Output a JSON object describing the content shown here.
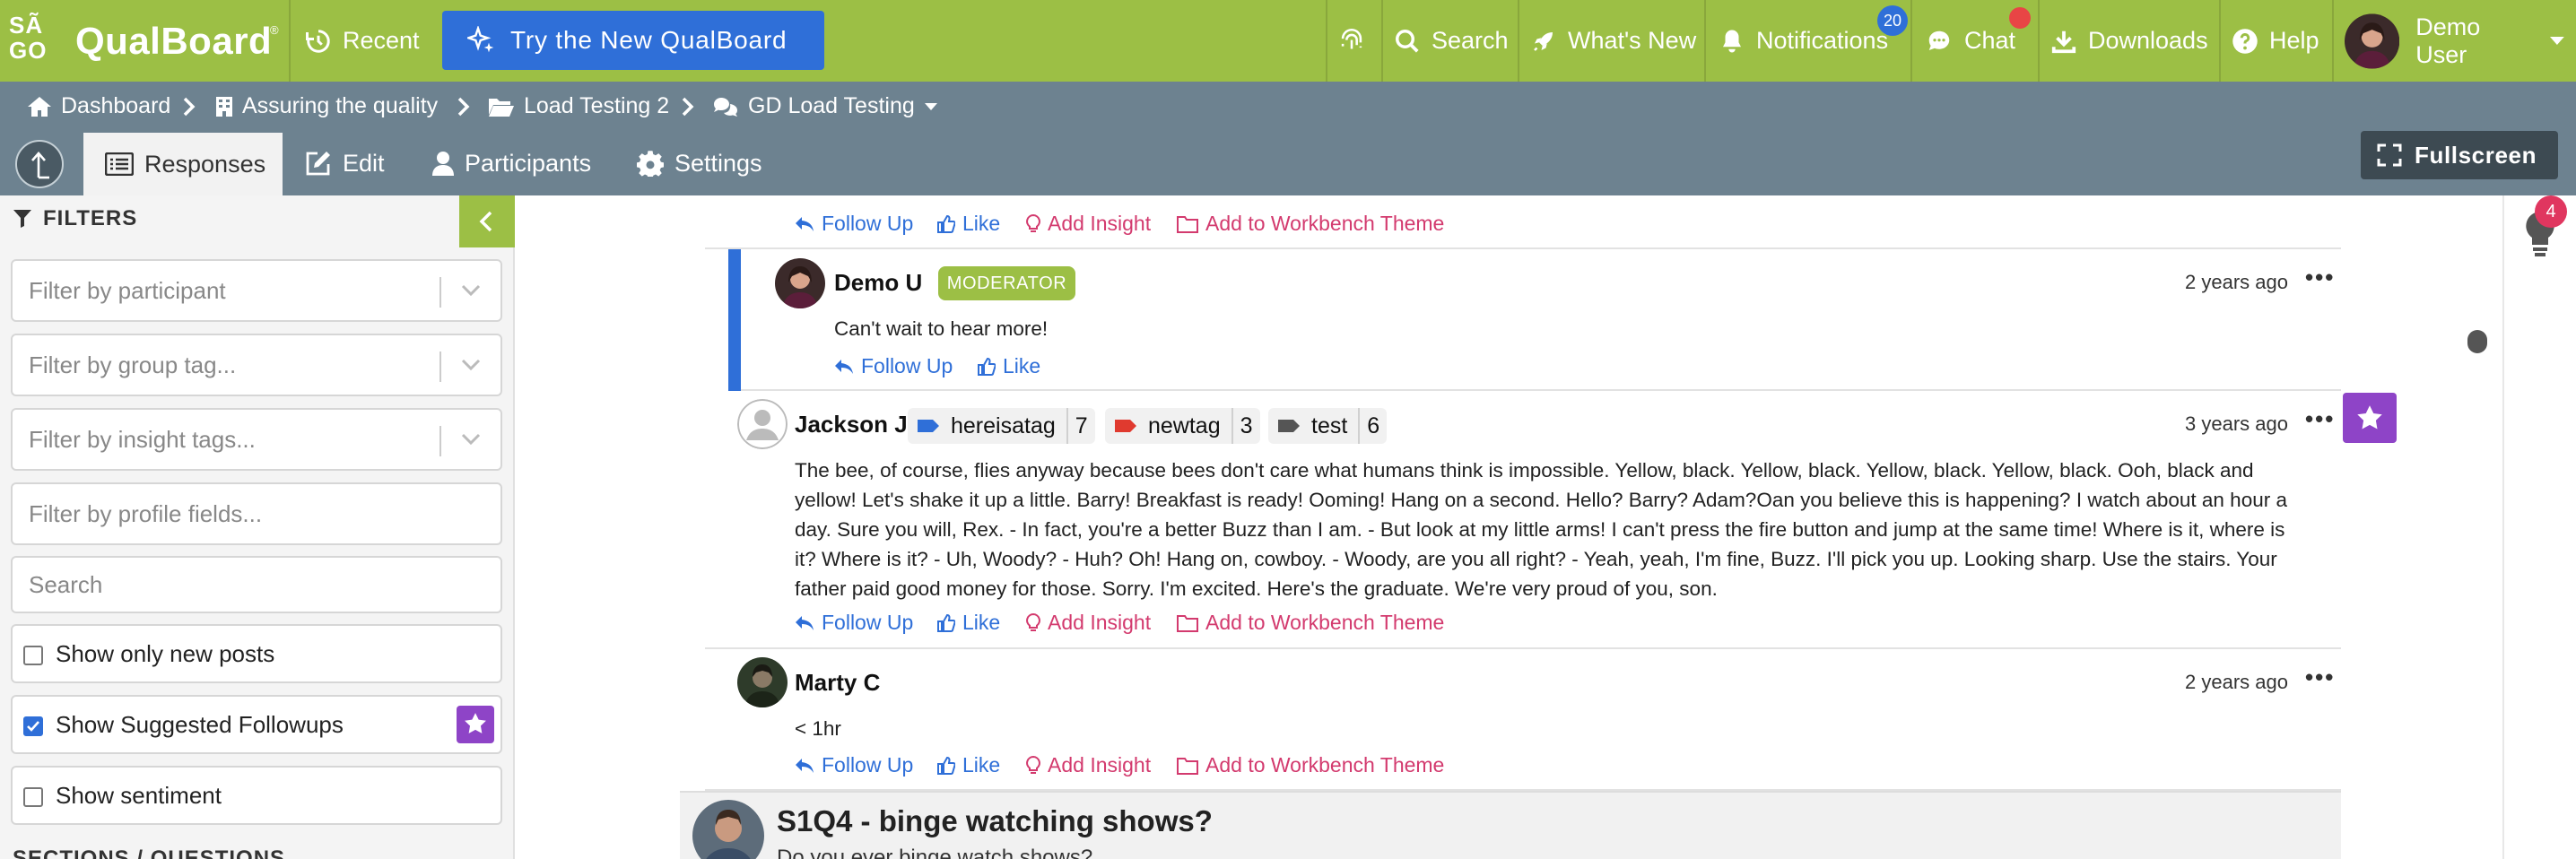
{
  "topbar": {
    "logo_sago": "SÃ GO",
    "logo_qual": "QualBoard",
    "logo_reg": "®",
    "recent": "Recent",
    "try_new": "Try the New QualBoard",
    "search": "Search",
    "whats_new": "What's New",
    "notifications": "Notifications",
    "notifications_count": "20",
    "chat": "Chat",
    "downloads": "Downloads",
    "help": "Help",
    "user": "Demo User"
  },
  "breadcrumb": {
    "dashboard": "Dashboard",
    "project": "Assuring the quality",
    "activity": "Load Testing 2",
    "discussion": "GD Load Testing"
  },
  "tabs": {
    "responses": "Responses",
    "edit": "Edit",
    "participants": "Participants",
    "settings": "Settings",
    "fullscreen": "Fullscreen"
  },
  "sidebar": {
    "title": "FILTERS",
    "participant_ph": "Filter by participant",
    "group_tag_ph": "Filter by group tag...",
    "insight_tags_ph": "Filter by insight tags...",
    "profile_fields_ph": "Filter by profile fields...",
    "search_ph": "Search",
    "show_new": "Show only new posts",
    "show_followups": "Show Suggested Followups",
    "show_sentiment": "Show sentiment",
    "sections_title": "SECTIONS / QUESTIONS"
  },
  "actions": {
    "follow_up": "Follow Up",
    "like": "Like",
    "add_insight": "Add Insight",
    "add_workbench": "Add to Workbench Theme"
  },
  "posts": [
    {
      "author": "Demo U",
      "role": "MODERATOR",
      "time": "2 years ago",
      "text": "Can't wait to hear more!"
    },
    {
      "author": "Jackson J",
      "time": "3 years ago",
      "tags": [
        {
          "name": "hereisatag",
          "count": "7",
          "color": "#2f6fd8"
        },
        {
          "name": "newtag",
          "count": "3",
          "color": "#e03a2f"
        },
        {
          "name": "test",
          "count": "6",
          "color": "#555555"
        }
      ],
      "text": "The bee, of course, flies anyway because bees don't care what humans think is impossible. Yellow, black. Yellow, black. Yellow, black. Yellow, black. Ooh, black and yellow! Let's shake it up a little. Barry! Breakfast is ready! Ooming! Hang on a second. Hello? Barry? Adam?Oan you believe this is happening? I watch about an hour a day. Sure you will, Rex. - In fact, you're a better Buzz than I am. - But look at my little arms! I can't press the fire button and jump at the same time! Where is it, where is it? Where is it? - Uh, Woody? - Huh? Oh! Hang on, cowboy. - Woody, are you all right? - Yeah, yeah, I'm fine, Buzz. I'll pick you up. Looking sharp. Use the stairs. Your father paid good money for those. Sorry. I'm excited. Here's the graduate. We're very proud of you, son."
    },
    {
      "author": "Marty C",
      "time": "2 years ago",
      "text": "< 1hr"
    }
  ],
  "question": {
    "title": "S1Q4 - binge watching shows?",
    "subtitle": "Do you ever binge watch shows?"
  },
  "insights_count": "4",
  "colors": {
    "brand_green": "#9cbf45",
    "nav_slate": "#6d8290",
    "primary_blue": "#2f6fd8",
    "insight_pink": "#d33a6e",
    "purple": "#8e44c7"
  }
}
